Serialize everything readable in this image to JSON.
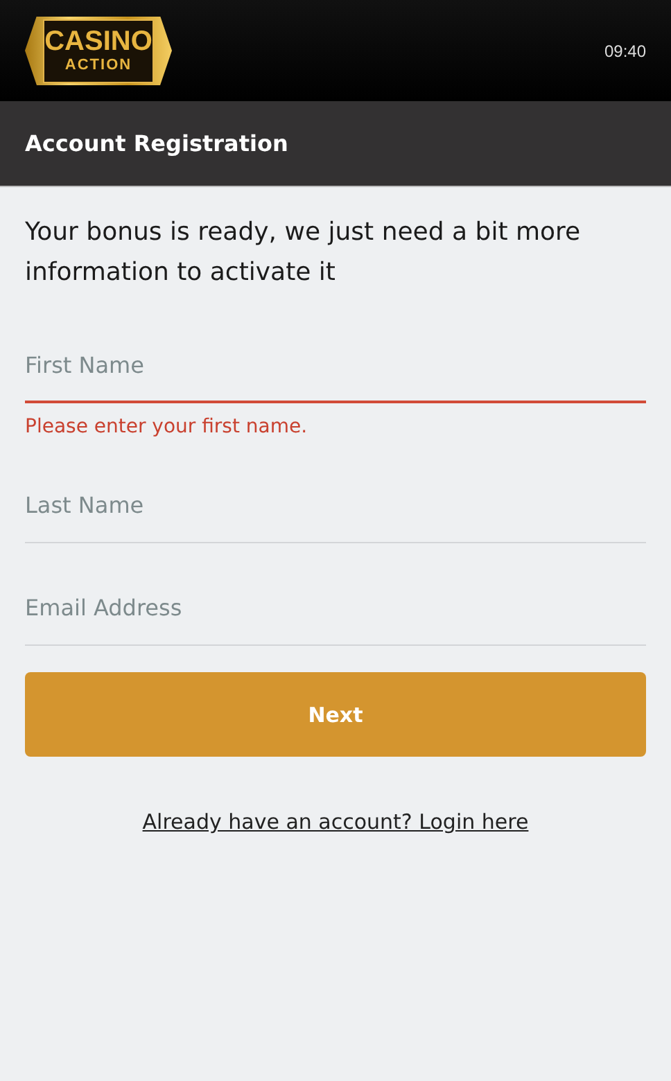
{
  "header": {
    "logo": {
      "line_1": "CASINO",
      "line_2": "ACTION"
    },
    "time": "09:40"
  },
  "title_bar": {
    "title": "Account Registration"
  },
  "intro": "Your bonus is ready, we just need a bit more information to activate it",
  "fields": [
    {
      "placeholder": "First Name",
      "invalid": true,
      "error": "Please enter your first name."
    },
    {
      "placeholder": "Last Name",
      "invalid": false
    },
    {
      "placeholder": "Email Address",
      "invalid": false
    }
  ],
  "next_button": "Next",
  "login_link": "Already have an account? Login here"
}
